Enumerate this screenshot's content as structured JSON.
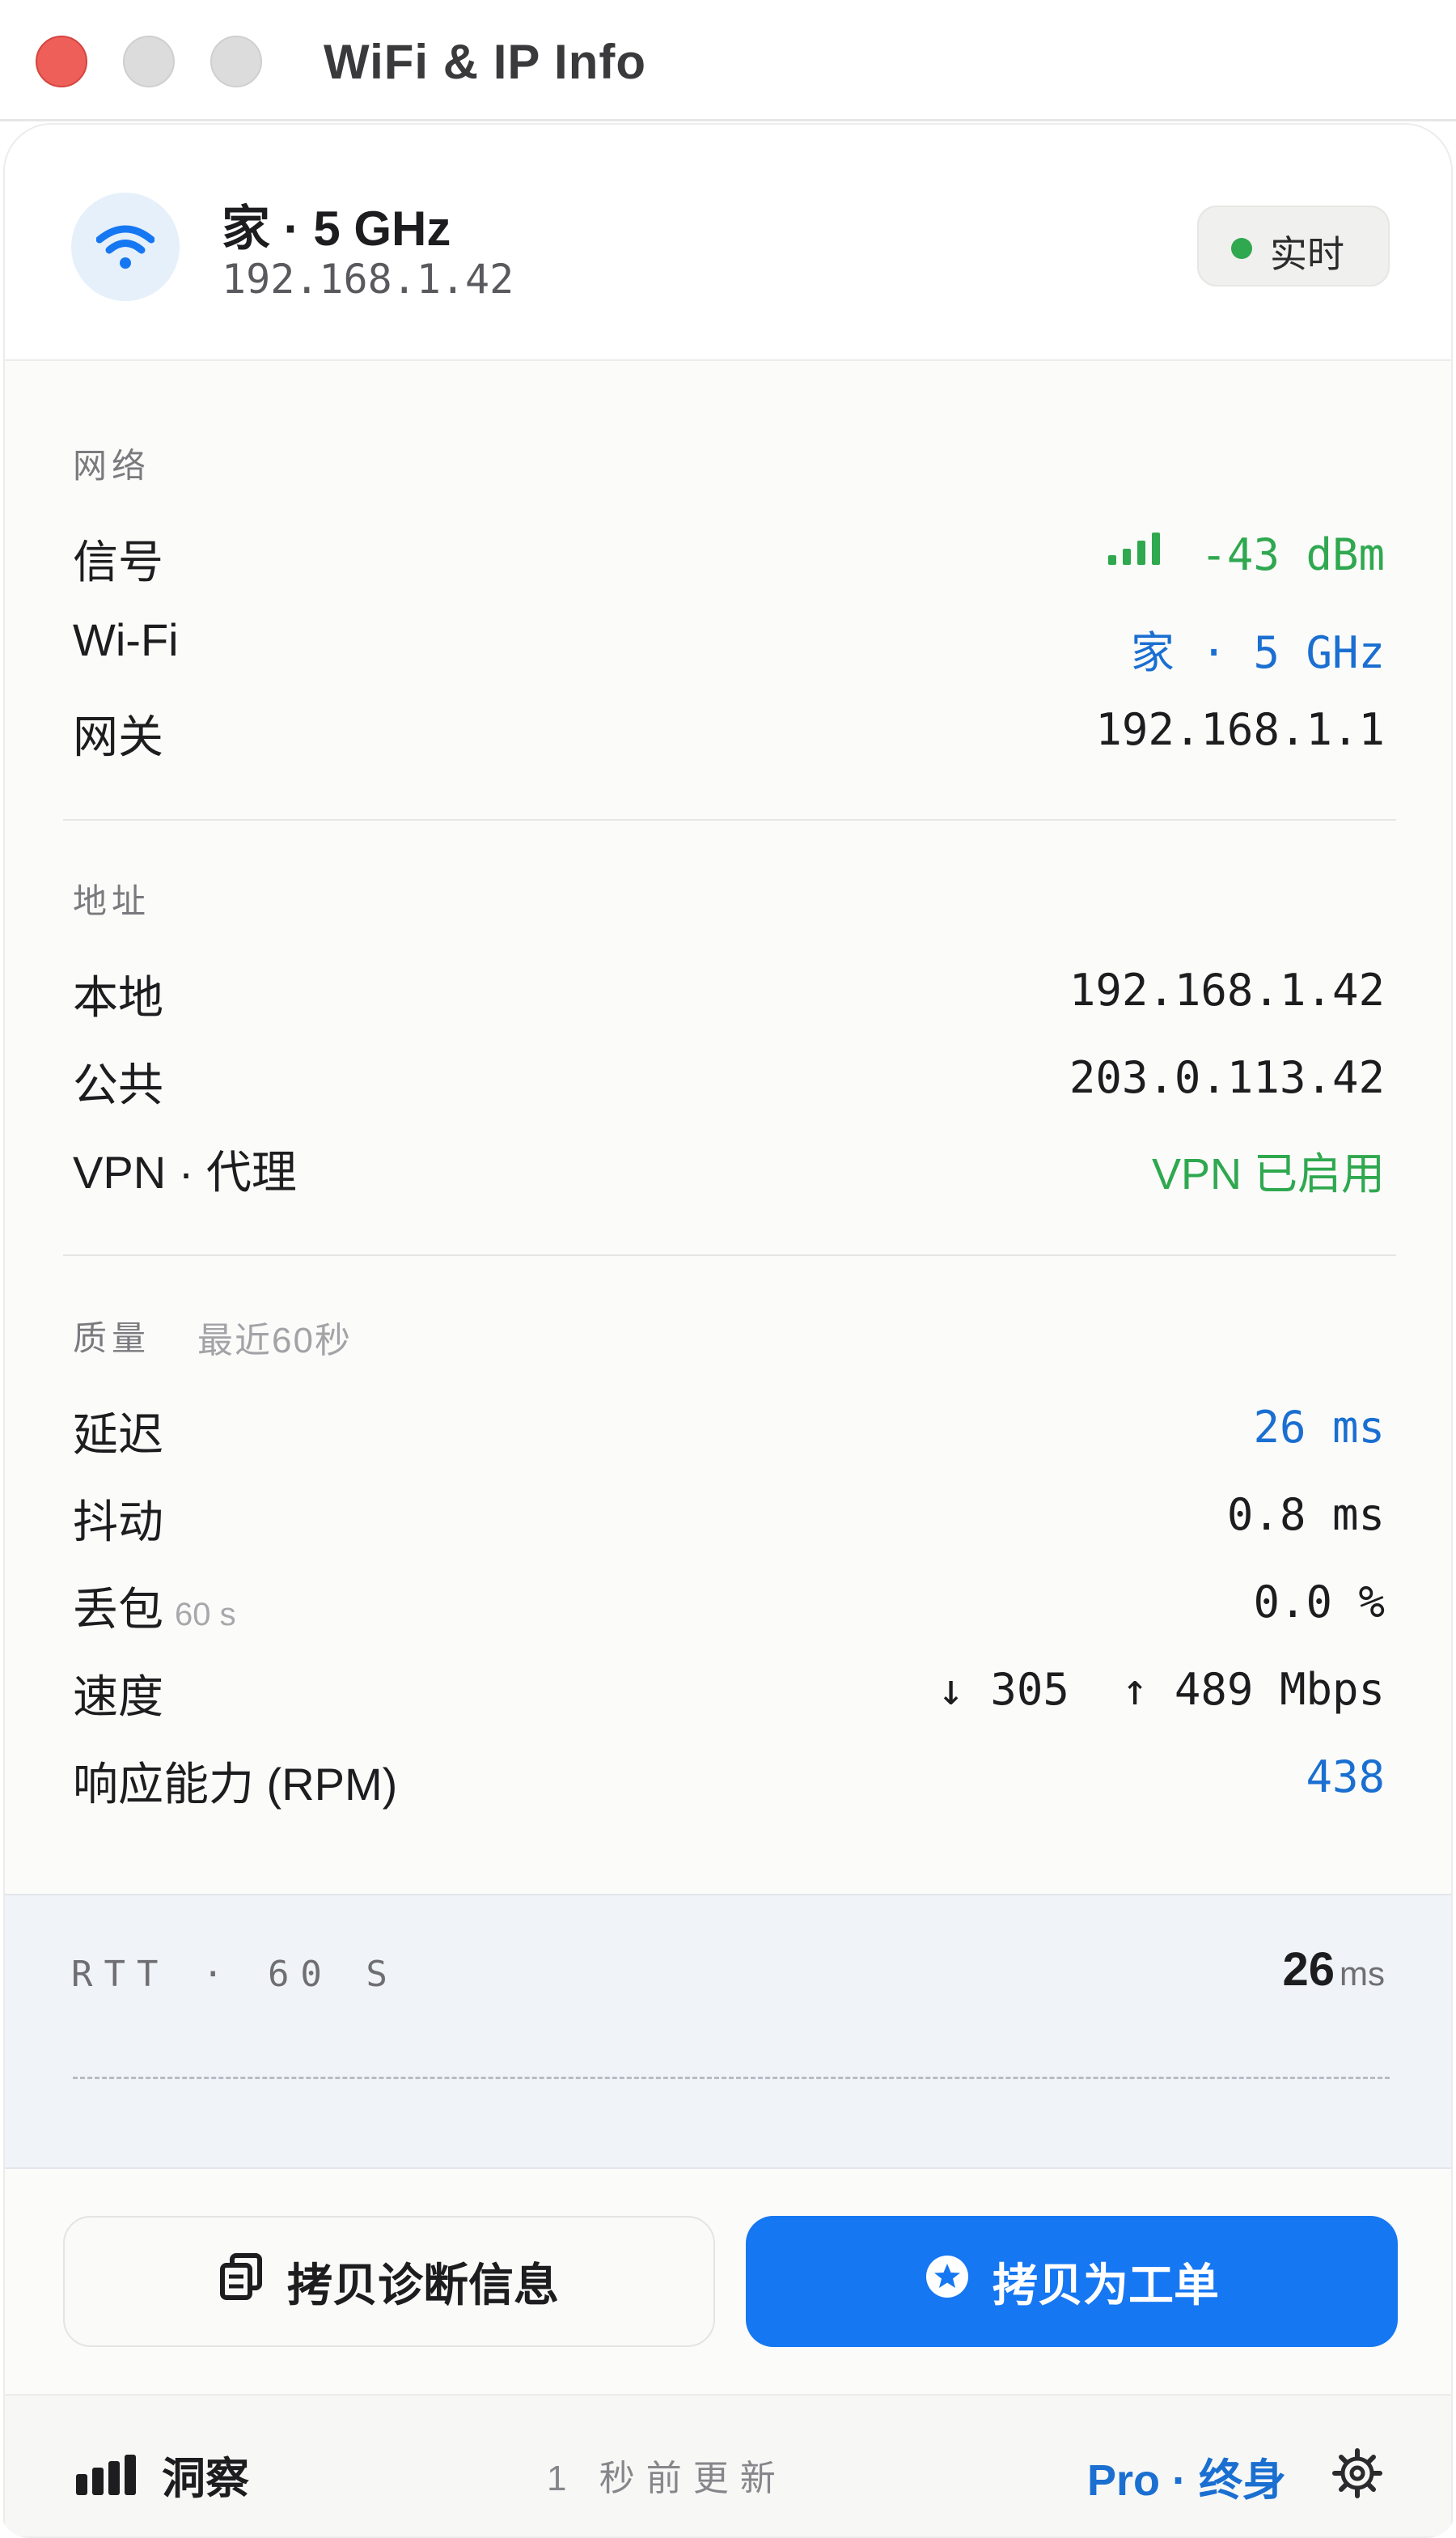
{
  "window": {
    "title": "WiFi & IP Info"
  },
  "header": {
    "network_name": "家 · 5 GHz",
    "local_ip": "192.168.1.42",
    "live_label": "实时",
    "icon": "wifi-icon"
  },
  "network": {
    "section_label": "网络",
    "rows": [
      {
        "label": "信号",
        "value": "-43 dBm",
        "color": "#2fa84f"
      },
      {
        "label": "Wi-Fi",
        "value": "家 · 5 GHz",
        "color": "#1a6fd1"
      },
      {
        "label": "网关",
        "value": "192.168.1.1",
        "color": "#1d1d1f"
      }
    ]
  },
  "address": {
    "section_label": "地址",
    "rows": [
      {
        "label": "本地",
        "value": "192.168.1.42"
      },
      {
        "label": "公共",
        "value": "203.0.113.42"
      },
      {
        "label": "VPN · 代理",
        "value": "VPN 已启用",
        "color": "#2fa84f"
      }
    ]
  },
  "quality": {
    "section_label": "质量",
    "section_sub": "最近60秒",
    "rows": [
      {
        "label": "延迟",
        "value": "26 ms",
        "color": "#1a6fd1"
      },
      {
        "label": "抖动",
        "value": "0.8 ms"
      },
      {
        "label": "丢包",
        "label_suffix": "60 s",
        "value": "0.0 %"
      },
      {
        "label": "速度",
        "value": "↓ 305  ↑ 489 Mbps"
      },
      {
        "label": "响应能力 (RPM)",
        "value": "438",
        "color": "#1a6fd1"
      }
    ]
  },
  "rtt": {
    "label": "RTT · 60 S",
    "value": "26",
    "unit": "ms"
  },
  "actions": {
    "copy_diagnostics": "拷贝诊断信息",
    "copy_ticket": "拷贝为工单"
  },
  "footer": {
    "insights": "洞察",
    "updated": "1 秒前更新",
    "plan": "Pro · 终身"
  },
  "colors": {
    "accent": "#1677f2",
    "green": "#2fa84f",
    "close": "#ee5f5a"
  }
}
